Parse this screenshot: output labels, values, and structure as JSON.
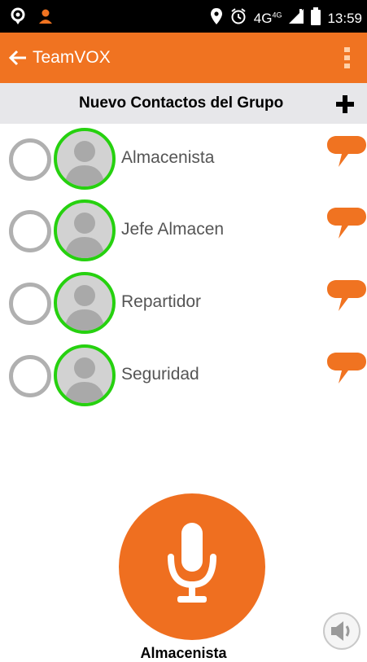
{
  "status_bar": {
    "network": "4G",
    "network_sup": "4G",
    "time": "13:59",
    "icons": [
      "location-icon",
      "person-icon",
      "location-pin-icon",
      "alarm-icon",
      "signal-icon",
      "battery-icon"
    ]
  },
  "toolbar": {
    "title": "TeamVOX",
    "back_icon": "arrow-left-icon",
    "menu_icon": "overflow-menu-icon"
  },
  "subheader": {
    "title": "Nuevo Contactos del Grupo",
    "add_icon": "plus-icon"
  },
  "contacts": [
    {
      "name": "Almacenista"
    },
    {
      "name": "Jefe Almacen"
    },
    {
      "name": "Repartidor"
    },
    {
      "name": "Seguridad"
    }
  ],
  "ptt": {
    "icon": "microphone-icon",
    "current_contact": "Almacenista",
    "speaker_icon": "speaker-icon"
  },
  "colors": {
    "accent": "#f07321",
    "online_ring": "#26d10f",
    "subheader_bg": "#e7e7ea"
  }
}
